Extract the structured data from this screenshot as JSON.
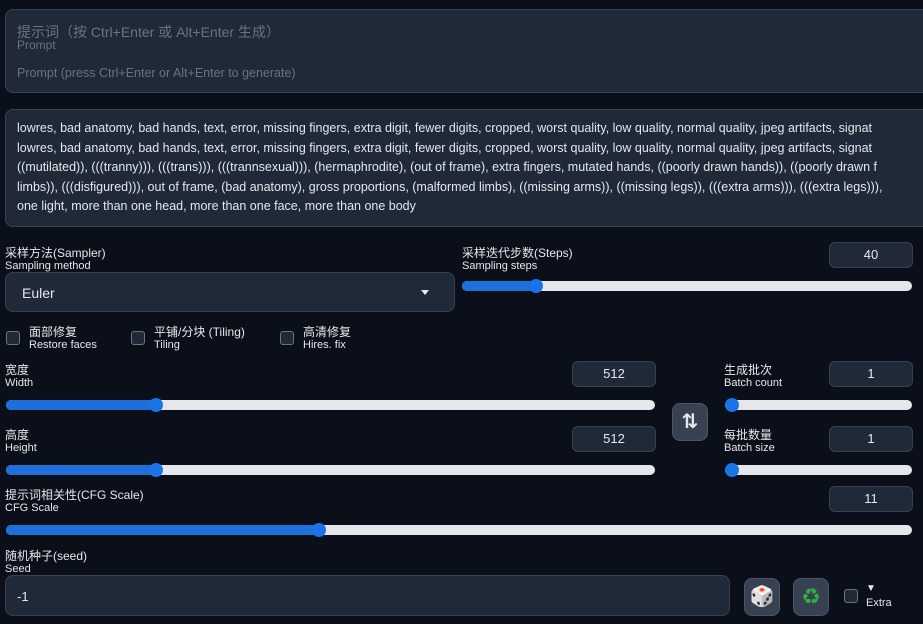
{
  "prompt": {
    "title": "提示词（按 Ctrl+Enter 或 Alt+Enter 生成）",
    "subtitle": "Prompt",
    "placeholder": "Prompt (press Ctrl+Enter or Alt+Enter to generate)"
  },
  "negative_prompt": {
    "lines": [
      "lowres, bad anatomy, bad hands, text, error, missing fingers, extra digit, fewer digits, cropped, worst quality, low quality, normal quality, jpeg artifacts, signat",
      "lowres, bad anatomy, bad hands, text, error, missing fingers, extra digit, fewer digits, cropped, worst quality, low quality, normal quality, jpeg artifacts, signat",
      "((mutilated)), (((tranny))), (((trans))), (((trannsexual))), (hermaphrodite), (out of frame), extra fingers, mutated hands, ((poorly drawn hands)), ((poorly drawn f",
      "limbs)), (((disfigured))), out of frame, (bad anatomy), gross proportions, (malformed limbs), ((missing arms)), ((missing legs)), (((extra arms))), (((extra legs))),",
      "one light, more than one head, more than one face, more than one body"
    ]
  },
  "sampler": {
    "label_zh": "采样方法(Sampler)",
    "label_en": "Sampling method",
    "value": "Euler"
  },
  "steps": {
    "label_zh": "采样迭代步数(Steps)",
    "label_en": "Sampling steps",
    "value": "40",
    "fraction": 0.164
  },
  "checkboxes": [
    {
      "label_zh": "面部修复",
      "label_en": "Restore faces",
      "checked": false
    },
    {
      "label_zh": "平铺/分块 (Tiling)",
      "label_en": "Tiling",
      "checked": false
    },
    {
      "label_zh": "高清修复",
      "label_en": "Hires. fix",
      "checked": false
    }
  ],
  "width": {
    "label_zh": "宽度",
    "label_en": "Width",
    "value": "512",
    "fraction": 0.231
  },
  "height": {
    "label_zh": "高度",
    "label_en": "Height",
    "value": "512",
    "fraction": 0.231
  },
  "batch_count": {
    "label_zh": "生成批次",
    "label_en": "Batch count",
    "value": "1",
    "fraction": 0.0
  },
  "batch_size": {
    "label_zh": "每批数量",
    "label_en": "Batch size",
    "value": "1",
    "fraction": 0.0
  },
  "cfg": {
    "label_zh": "提示词相关性(CFG Scale)",
    "label_en": "CFG Scale",
    "value": "11",
    "fraction": 0.345
  },
  "seed": {
    "label_zh": "随机种子(seed)",
    "label_en": "Seed",
    "value": "-1"
  },
  "extra": {
    "label": "Extra",
    "arrow": "▼"
  },
  "icons": {
    "swap": "⇅",
    "dice": "🎲",
    "recycle": "♻"
  },
  "colors": {
    "accent": "#1a73e8",
    "background": "#0b0f19",
    "panel": "#1f2937"
  }
}
